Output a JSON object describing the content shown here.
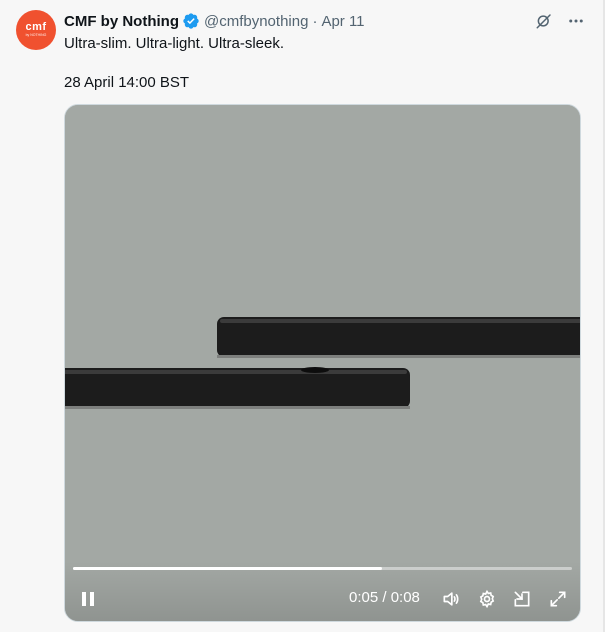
{
  "author": {
    "avatar_text": "cmf",
    "avatar_subtext": "by NOTHING",
    "name": "CMF by Nothing",
    "handle": "@cmfbynothing",
    "separator": "·",
    "time": "Apr 11"
  },
  "tweet": {
    "text": "Ultra-slim. Ultra-light. Ultra-sleek.",
    "date_line": "28 April 14:00 BST"
  },
  "video": {
    "time_display": "0:05 / 0:08",
    "progress": 0.62
  },
  "colors": {
    "accent": "#1d9bf0",
    "brand": "#f0512f",
    "video_bg": "#a3a8a4"
  }
}
